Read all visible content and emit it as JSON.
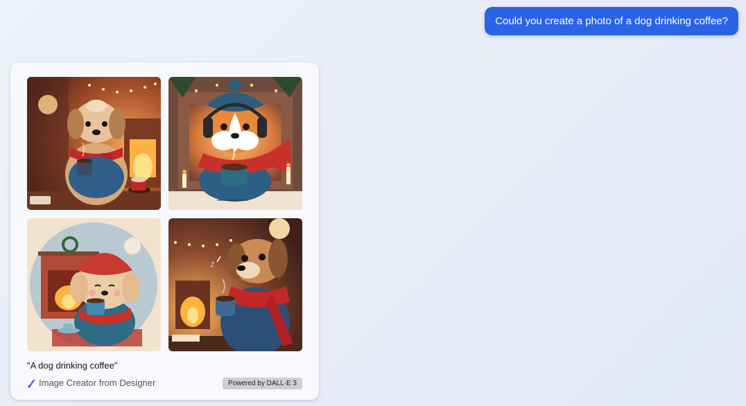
{
  "user_message": "Could you create a photo of a dog drinking coffee?",
  "result": {
    "caption": "\"A dog drinking coffee\"",
    "creator_label": "Image Creator from Designer",
    "badge": "Powered by DALL·E 3"
  },
  "colors": {
    "user_bubble": "#2a63e6",
    "card_bg": "#f8f9fd",
    "page_bg": "#e8ecf7"
  }
}
